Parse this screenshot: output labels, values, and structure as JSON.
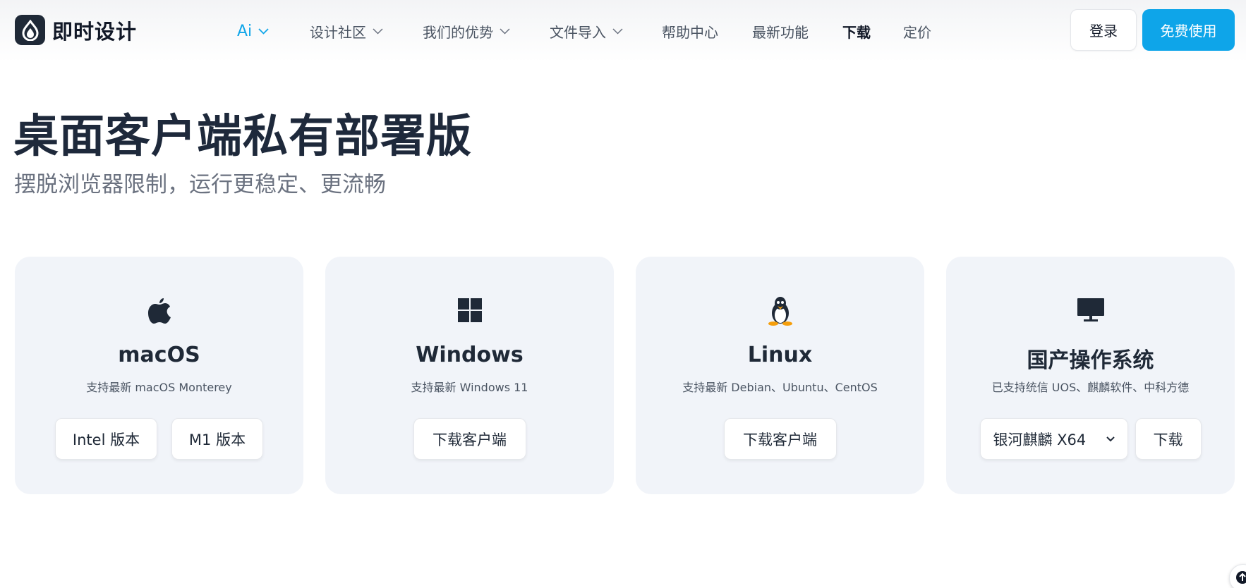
{
  "header": {
    "logo_text": "即时设计",
    "nav": [
      {
        "label": "Ai"
      },
      {
        "label": "设计社区"
      },
      {
        "label": "我们的优势"
      },
      {
        "label": "文件导入"
      },
      {
        "label": "帮助中心"
      },
      {
        "label": "最新功能"
      },
      {
        "label": "下载"
      },
      {
        "label": "定价"
      }
    ],
    "login_label": "登录",
    "signup_label": "免费使用"
  },
  "hero": {
    "title": "桌面客户端私有部署版",
    "subtitle": "摆脱浏览器限制，运行更稳定、更流畅"
  },
  "cards": [
    {
      "icon": "apple-icon",
      "name": "macOS",
      "desc": "支持最新 macOS Monterey",
      "buttons": [
        "Intel 版本",
        "M1 版本"
      ]
    },
    {
      "icon": "windows-icon",
      "name": "Windows",
      "desc": "支持最新 Windows 11",
      "buttons": [
        "下载客户端"
      ]
    },
    {
      "icon": "linux-icon",
      "name": "Linux",
      "desc": "支持最新 Debian、Ubuntu、CentOS",
      "buttons": [
        "下载客户端"
      ]
    },
    {
      "icon": "monitor-icon",
      "name": "国产操作系统",
      "desc": "已支持统信 UOS、麒麟软件、中科方德",
      "select_value": "银河麒麟 X64",
      "buttons": [
        "下载"
      ]
    }
  ],
  "colors": {
    "accent": "#0ea5e9",
    "card_bg": "#f1f4f9",
    "text_dark": "#1f2937"
  }
}
